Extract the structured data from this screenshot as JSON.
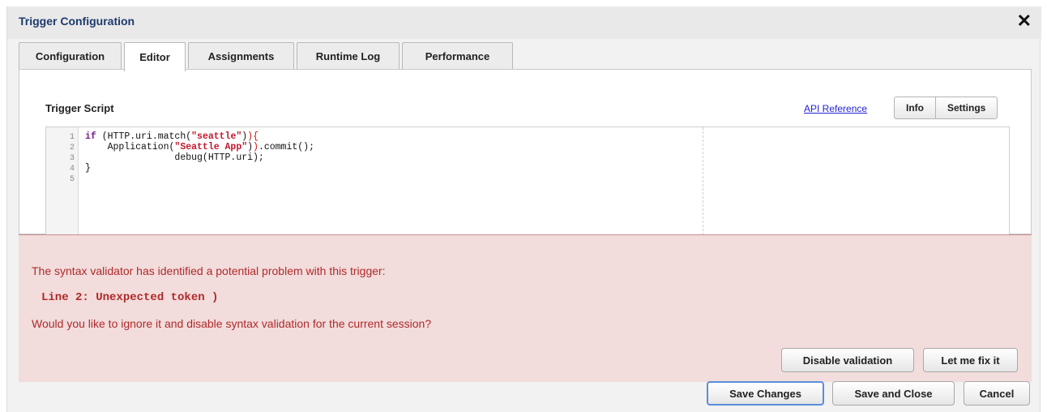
{
  "dialog": {
    "title": "Trigger Configuration",
    "close_glyph": "✕"
  },
  "tabs": [
    {
      "label": "Configuration",
      "active": false
    },
    {
      "label": "Editor",
      "active": true
    },
    {
      "label": "Assignments",
      "active": false
    },
    {
      "label": "Runtime Log",
      "active": false
    },
    {
      "label": "Performance",
      "active": false
    }
  ],
  "editor": {
    "label": "Trigger Script",
    "api_link": "API Reference",
    "info_button": "Info",
    "settings_button": "Settings",
    "line_numbers": [
      "1",
      "2",
      "3",
      "4",
      "5"
    ],
    "code_lines": [
      "if (HTTP.uri.match(\"seattle\")){",
      "    Application(\"Seattle App\")).commit();",
      "                debug(HTTP.uri);",
      "}",
      ""
    ]
  },
  "validation": {
    "message": "The syntax validator has identified a potential problem with this trigger:",
    "error": "Line 2: Unexpected token )",
    "question": "Would you like to ignore it and disable syntax validation for the current session?",
    "disable_button": "Disable validation",
    "fix_button": "Let me fix it",
    "bg_color": "#f2dcdc",
    "text_color": "#b02a2a"
  },
  "footer": {
    "save_changes": "Save Changes",
    "save_close": "Save and Close",
    "cancel": "Cancel"
  },
  "colors": {
    "title": "#1e3a6e",
    "link": "#2424d6",
    "primary_border": "#5a8ed8"
  }
}
